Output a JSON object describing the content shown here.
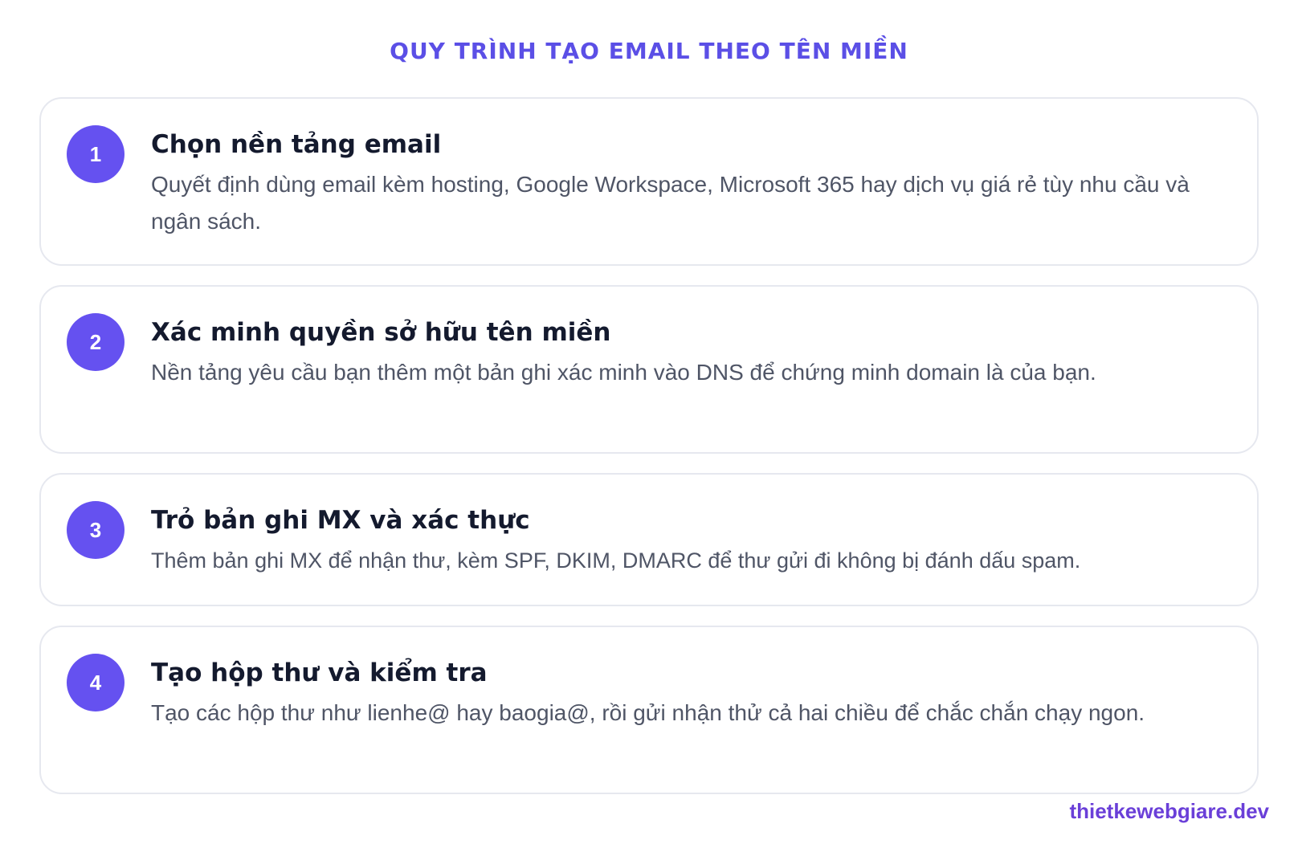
{
  "header": {
    "title": "QUY TRÌNH TẠO EMAIL THEO TÊN MIỀN"
  },
  "steps": [
    {
      "number": "1",
      "title": "Chọn nền tảng email",
      "description": "Quyết định dùng email kèm hosting, Google Workspace, Microsoft 365 hay dịch vụ giá rẻ tùy nhu cầu và ngân sách."
    },
    {
      "number": "2",
      "title": "Xác minh quyền sở hữu tên miền",
      "description": "Nền tảng yêu cầu bạn thêm một bản ghi xác minh vào DNS để chứng minh domain là của bạn."
    },
    {
      "number": "3",
      "title": "Trỏ bản ghi MX và xác thực",
      "description": "Thêm bản ghi MX để nhận thư, kèm SPF, DKIM, DMARC để thư gửi đi không bị đánh dấu spam."
    },
    {
      "number": "4",
      "title": "Tạo hộp thư và kiểm tra",
      "description": "Tạo các hộp thư như lienhe@ hay baogia@, rồi gửi nhận thử cả hai chiều để chắc chắn chạy ngon."
    }
  ],
  "footer": {
    "brand": "thietkewebgiare.dev"
  },
  "colors": {
    "accent": "#6551f0",
    "title": "#5b4fe6",
    "brand": "#6a3fd8"
  }
}
